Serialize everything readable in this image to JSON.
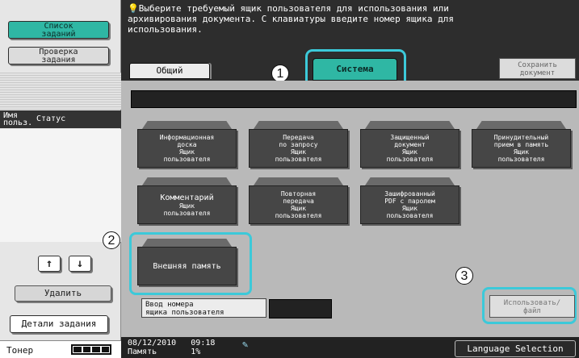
{
  "sidebar": {
    "job_list": [
      "Список",
      "заданий"
    ],
    "job_check": [
      "Проверка",
      "задания"
    ],
    "columns": {
      "user": [
        "Имя",
        "польз."
      ],
      "status": "Статус"
    },
    "up_icon": "arrow-up-icon",
    "down_icon": "arrow-down-icon",
    "delete_label": "Удалить",
    "job_details_label": "Детали задания",
    "toner_label": "Тонер",
    "toner_level": 1.0
  },
  "main": {
    "message": "Выберите требуемый ящик пользователя для использования или архивирования документа. С клавиатуры введите номер ящика для использования.",
    "tabs": {
      "general": "Общий",
      "system": "Система"
    },
    "save_doc": [
      "Сохранить",
      "документ"
    ],
    "boxes": [
      [
        "Информационная",
        "доска",
        "Ящик",
        "пользователя"
      ],
      [
        "Передача",
        "по запросу",
        "Ящик",
        "пользователя"
      ],
      [
        "Защищенный",
        "документ",
        "Ящик",
        "пользователя"
      ],
      [
        "Принудительный",
        "прием в память",
        "Ящик",
        "пользователя"
      ],
      [
        "Комментарий",
        "Ящик",
        "пользователя"
      ],
      [
        "Повторная",
        "передача",
        "Ящик",
        "пользователя"
      ],
      [
        "Зашифрованный",
        "PDF с паролем",
        "Ящик",
        "пользователя"
      ],
      [
        "Внешняя память"
      ]
    ],
    "input_box": [
      "Ввод номера",
      "ящика пользователя"
    ],
    "use_file": [
      "Использовать/",
      "файл"
    ],
    "callouts": [
      "1",
      "2",
      "3"
    ]
  },
  "status_bar": {
    "date": "08/12/2010",
    "time": "09:18",
    "memory_label": "Память",
    "memory_value": "1%",
    "memory_icon": "memory-icon",
    "language_button": "Language Selection"
  },
  "colors": {
    "accent": "#2fb7a4",
    "highlight": "#3cc9d9",
    "panel_dark": "#2d2d2d",
    "content_gray": "#b9b9b9"
  }
}
